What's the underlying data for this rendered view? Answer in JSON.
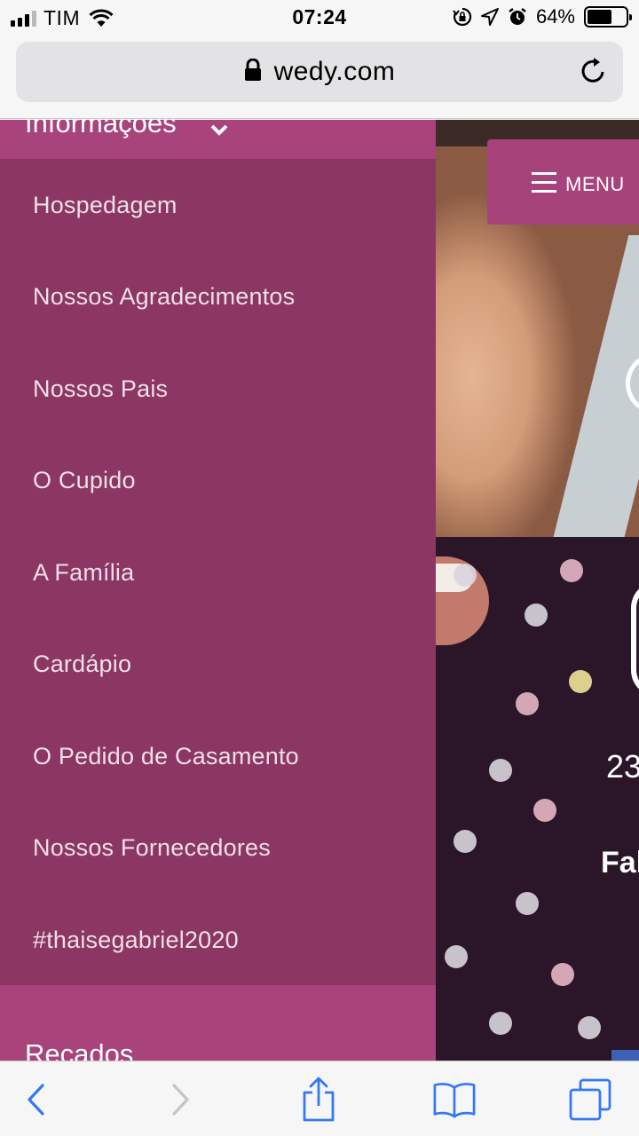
{
  "status_bar": {
    "carrier": "TIM",
    "time": "07:24",
    "battery_percent": "64%",
    "battery_level": 0.64,
    "icons": [
      "signal-icon",
      "wifi-icon",
      "orientation-lock-icon",
      "location-icon",
      "alarm-icon",
      "battery-icon"
    ]
  },
  "browser": {
    "url": "wedy.com",
    "icons": [
      "lock-icon",
      "reload-icon"
    ]
  },
  "menu_button": {
    "label": "MENU",
    "icon": "hamburger-icon"
  },
  "drawer": {
    "section_info": {
      "label": "Informações",
      "icon": "chevron-down-icon"
    },
    "items": [
      {
        "label": "Hospedagem"
      },
      {
        "label": "Nossos Agradecimentos"
      },
      {
        "label": "Nossos Pais"
      },
      {
        "label": "O Cupido"
      },
      {
        "label": "A Família"
      },
      {
        "label": "Cardápio"
      },
      {
        "label": "O Pedido de Casamento"
      },
      {
        "label": "Nossos Fornecedores"
      },
      {
        "label": "#thaisegabriel2020"
      }
    ],
    "section_recados": {
      "label": "Recados"
    }
  },
  "hero": {
    "date_fragment": "23",
    "name_fragment": "Fal"
  },
  "toolbar": {
    "icons": [
      "back-icon",
      "forward-icon",
      "share-icon",
      "bookmarks-icon",
      "tabs-icon"
    ]
  },
  "colors": {
    "drawer_header": "#a9437b",
    "drawer_submenu": "#8b3663",
    "submenu_text": "#eedfe7",
    "ios_blue": "#3478f6",
    "ios_disabled": "#c4c4c7"
  }
}
